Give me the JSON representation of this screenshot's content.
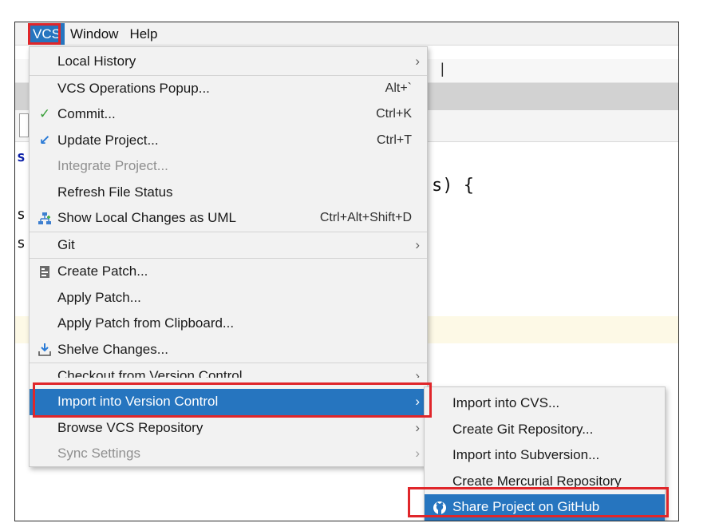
{
  "menubar": {
    "items": [
      {
        "label": "VCS",
        "active": true
      },
      {
        "label": "Window"
      },
      {
        "label": "Help"
      }
    ]
  },
  "editor": {
    "code_fragment": "s) {",
    "left_glyphs": [
      "s",
      "s",
      "s"
    ]
  },
  "vcs_menu": {
    "items": [
      {
        "label": "Local History",
        "submenu": true
      },
      {
        "label": "VCS Operations Popup...",
        "shortcut": "Alt+`"
      },
      {
        "label": "Commit...",
        "shortcut": "Ctrl+K",
        "icon": "check-icon"
      },
      {
        "label": "Update Project...",
        "shortcut": "Ctrl+T",
        "icon": "update-arrow-icon"
      },
      {
        "label": "Integrate Project...",
        "disabled": true
      },
      {
        "label": "Refresh File Status"
      },
      {
        "label": "Show Local Changes as UML",
        "shortcut": "Ctrl+Alt+Shift+D",
        "icon": "uml-diagram-icon"
      },
      {
        "label": "Git",
        "submenu": true
      },
      {
        "label": "Create Patch...",
        "icon": "patch-icon"
      },
      {
        "label": "Apply Patch..."
      },
      {
        "label": "Apply Patch from Clipboard..."
      },
      {
        "label": "Shelve Changes...",
        "icon": "shelve-icon"
      },
      {
        "label": "Checkout from Version Control",
        "submenu": true
      },
      {
        "label": "Import into Version Control",
        "submenu": true,
        "selected": true
      },
      {
        "label": "Browse VCS Repository",
        "submenu": true
      },
      {
        "label": "Sync Settings",
        "submenu": true,
        "disabled": true
      }
    ]
  },
  "import_submenu": {
    "items": [
      {
        "label": "Import into CVS..."
      },
      {
        "label": "Create Git Repository..."
      },
      {
        "label": "Import into Subversion..."
      },
      {
        "label": "Create Mercurial Repository"
      },
      {
        "label": "Share Project on GitHub",
        "icon": "github-icon",
        "selected": true
      }
    ]
  },
  "colors": {
    "selection": "#2675bf",
    "highlight_box": "#e0262a",
    "menu_bg": "#f2f2f2"
  }
}
